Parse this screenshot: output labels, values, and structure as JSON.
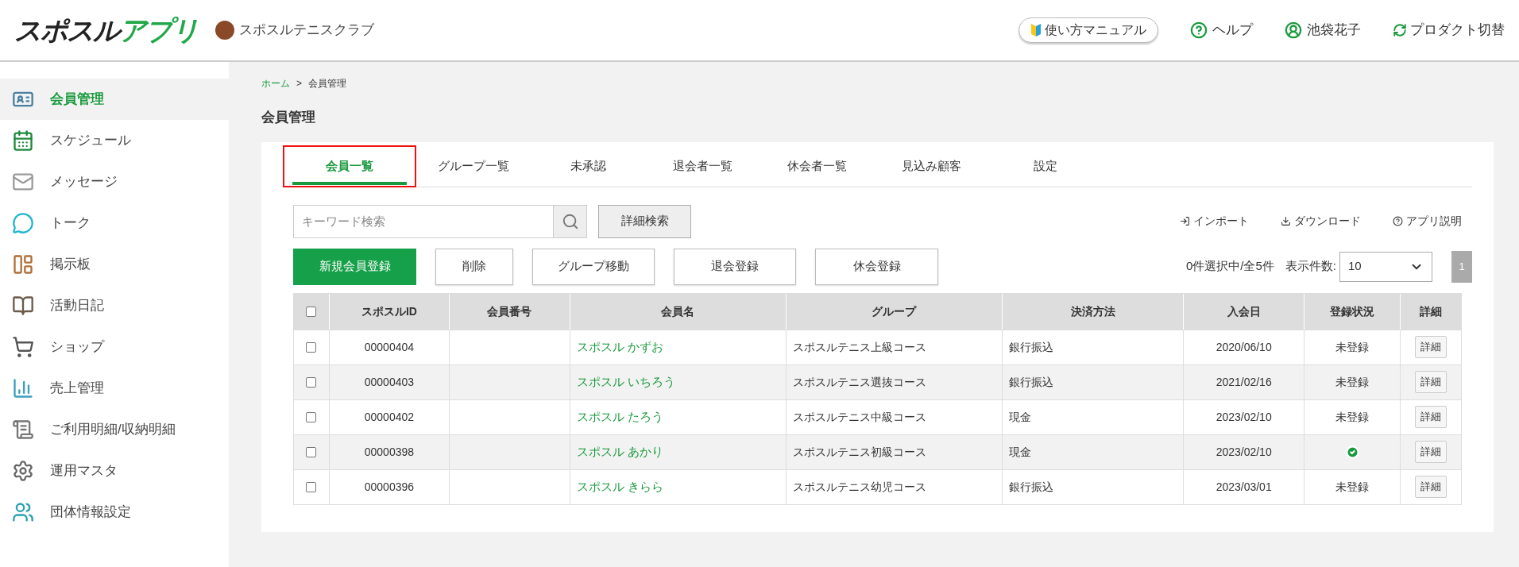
{
  "header": {
    "logo": {
      "dark": "スポスル",
      "green": "アプリ"
    },
    "club": "スポスルテニスクラブ",
    "manual_button": "使い方マニュアル",
    "help": "ヘルプ",
    "user": "池袋花子",
    "switch": "プロダクト切替"
  },
  "sidebar": {
    "items": [
      {
        "label": "会員管理",
        "selected": true
      },
      {
        "label": "スケジュール",
        "selected": false
      },
      {
        "label": "メッセージ",
        "selected": false
      },
      {
        "label": "トーク",
        "selected": false
      },
      {
        "label": "掲示板",
        "selected": false
      },
      {
        "label": "活動日記",
        "selected": false
      },
      {
        "label": "ショップ",
        "selected": false
      },
      {
        "label": "売上管理",
        "selected": false
      },
      {
        "label": "ご利用明細/収納明細",
        "selected": false
      },
      {
        "label": "運用マスタ",
        "selected": false
      },
      {
        "label": "団体情報設定",
        "selected": false
      }
    ]
  },
  "breadcrumb": [
    "ホーム",
    "会員管理"
  ],
  "breadcrumb_separator": ">",
  "page_title": "会員管理",
  "tabs": [
    {
      "label": "会員一覧",
      "selected": true,
      "highlighted": true
    },
    {
      "label": "グループ一覧",
      "selected": false,
      "highlighted": false
    },
    {
      "label": "未承認",
      "selected": false,
      "highlighted": false
    },
    {
      "label": "退会者一覧",
      "selected": false,
      "highlighted": false
    },
    {
      "label": "休会者一覧",
      "selected": false,
      "highlighted": false
    },
    {
      "label": "見込み顧客",
      "selected": false,
      "highlighted": false
    },
    {
      "label": "設定",
      "selected": false,
      "highlighted": false
    }
  ],
  "search": {
    "placeholder": "キーワード検索",
    "detail_button": "詳細検索"
  },
  "links": [
    "インポート",
    "ダウンロード",
    "アプリ説明"
  ],
  "actions": [
    {
      "label": "新規会員登録",
      "primary": true
    },
    {
      "label": "削除",
      "primary": false
    },
    {
      "label": "グループ移動",
      "primary": false
    },
    {
      "label": "退会登録",
      "primary": false
    },
    {
      "label": "休会登録",
      "primary": false
    }
  ],
  "selection_info": "0件選択中/全5件",
  "page_size": {
    "label": "表示件数:",
    "value": "10"
  },
  "pagination": [
    "1"
  ],
  "table": {
    "columns": [
      "スポスルID",
      "会員番号",
      "会員名",
      "グループ",
      "決済方法",
      "入会日",
      "登録状況",
      "詳細"
    ],
    "header_checked": false,
    "rows": [
      {
        "checked": false,
        "id": "00000404",
        "name": "スポスル かずお",
        "group": "スポスルテニス上級コース",
        "payment": "銀行振込",
        "joined": "2020/06/10",
        "registered": false,
        "status": "未登録",
        "detail": "詳細"
      },
      {
        "checked": false,
        "id": "00000403",
        "name": "スポスル いちろう",
        "group": "スポスルテニス選抜コース",
        "payment": "銀行振込",
        "joined": "2021/02/16",
        "registered": false,
        "status": "未登録",
        "detail": "詳細"
      },
      {
        "checked": false,
        "id": "00000402",
        "name": "スポスル たろう",
        "group": "スポスルテニス中級コース",
        "payment": "現金",
        "joined": "2023/02/10",
        "registered": false,
        "status": "未登録",
        "detail": "詳細"
      },
      {
        "checked": false,
        "id": "00000398",
        "name": "スポスル あかり",
        "group": "スポスルテニス初級コース",
        "payment": "現金",
        "joined": "2023/02/10",
        "registered": true,
        "detail": "詳細"
      },
      {
        "checked": false,
        "id": "00000396",
        "name": "スポスル きらら",
        "group": "スポスルテニス幼児コース",
        "payment": "銀行振込",
        "joined": "2023/03/01",
        "registered": false,
        "status": "未登録",
        "detail": "詳細"
      }
    ]
  }
}
